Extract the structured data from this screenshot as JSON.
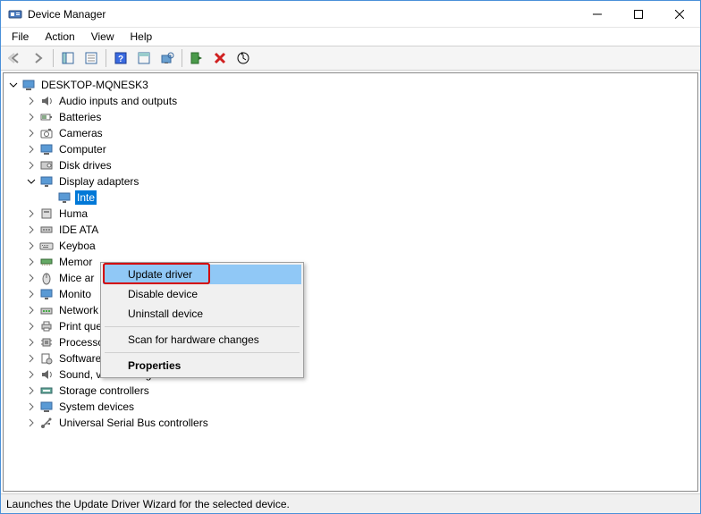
{
  "window": {
    "title": "Device Manager"
  },
  "menubar": {
    "file": "File",
    "action": "Action",
    "view": "View",
    "help": "Help"
  },
  "tree": {
    "root": "DESKTOP-MQNESK3",
    "categories": [
      {
        "label": "Audio inputs and outputs",
        "expanded": false
      },
      {
        "label": "Batteries",
        "expanded": false
      },
      {
        "label": "Cameras",
        "expanded": false
      },
      {
        "label": "Computer",
        "expanded": false
      },
      {
        "label": "Disk drives",
        "expanded": false
      },
      {
        "label": "Display adapters",
        "expanded": true,
        "children": [
          {
            "label": "Inte",
            "selected": true
          }
        ]
      },
      {
        "label": "Huma",
        "expanded": false
      },
      {
        "label": "IDE ATA",
        "expanded": false
      },
      {
        "label": "Keyboa",
        "expanded": false
      },
      {
        "label": "Memor",
        "expanded": false
      },
      {
        "label": "Mice ar",
        "expanded": false
      },
      {
        "label": "Monito",
        "expanded": false
      },
      {
        "label": "Network adapters",
        "expanded": false
      },
      {
        "label": "Print queues",
        "expanded": false
      },
      {
        "label": "Processors",
        "expanded": false
      },
      {
        "label": "Software devices",
        "expanded": false
      },
      {
        "label": "Sound, video and game controllers",
        "expanded": false
      },
      {
        "label": "Storage controllers",
        "expanded": false
      },
      {
        "label": "System devices",
        "expanded": false
      },
      {
        "label": "Universal Serial Bus controllers",
        "expanded": false
      }
    ]
  },
  "context_menu": {
    "update_driver": "Update driver",
    "disable_device": "Disable device",
    "uninstall_device": "Uninstall device",
    "scan_hardware": "Scan for hardware changes",
    "properties": "Properties"
  },
  "statusbar": {
    "text": "Launches the Update Driver Wizard for the selected device."
  },
  "colors": {
    "selection": "#0078d7",
    "ctx_highlight": "#90c8f6",
    "annotation_red": "#d40000",
    "window_border": "#4a90d9"
  }
}
